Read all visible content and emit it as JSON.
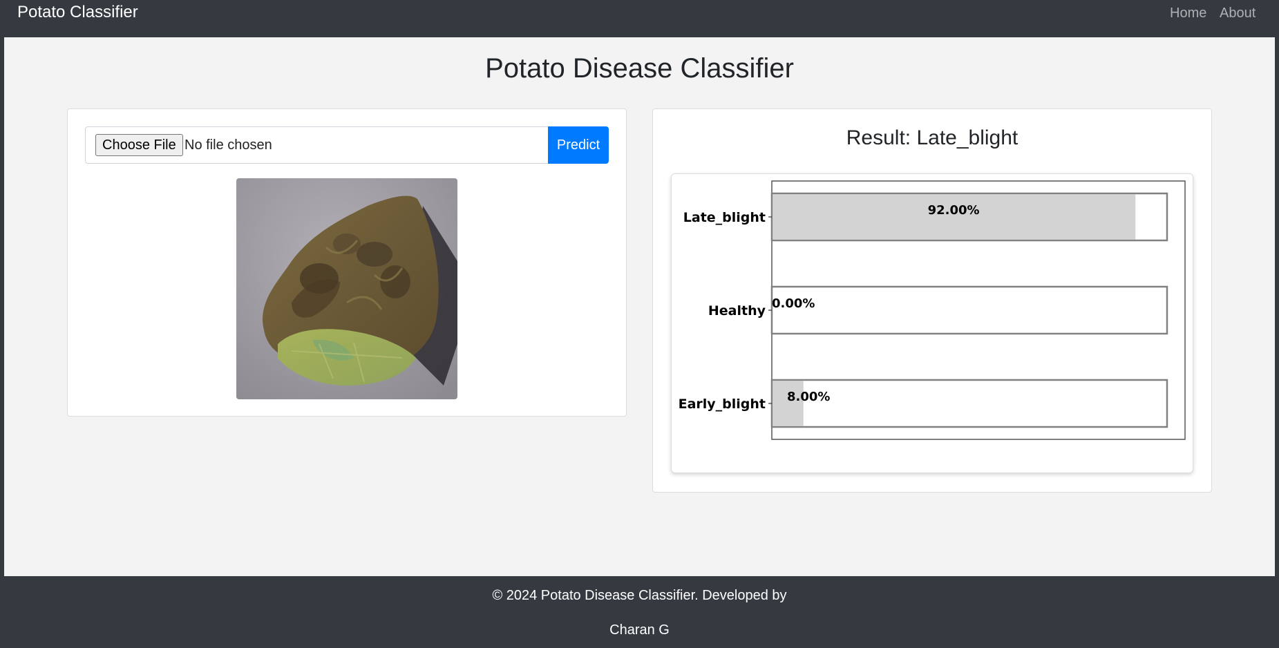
{
  "navbar": {
    "brand": "Potato Classifier",
    "links": [
      "Home",
      "About"
    ]
  },
  "page": {
    "title": "Potato Disease Classifier"
  },
  "upload": {
    "choose_label": "Choose File",
    "file_status": "No file chosen",
    "predict_label": "Predict"
  },
  "result": {
    "title": "Result: Late_blight"
  },
  "chart_data": {
    "type": "bar",
    "orientation": "horizontal",
    "categories": [
      "Late_blight",
      "Healthy",
      "Early_blight"
    ],
    "values": [
      92.0,
      0.0,
      8.0
    ],
    "value_labels": [
      "92.00%",
      "0.00%",
      "8.00%"
    ],
    "xlim": [
      0,
      100
    ],
    "bar_color": "#d3d3d3",
    "track_color": "#ffffff",
    "border_color": "#808080"
  },
  "footer": {
    "line1": "© 2024 Potato Disease Classifier. Developed by",
    "line2": "Charan G"
  },
  "colors": {
    "navbar": "#343a40",
    "primary": "#007bff",
    "background": "#f3f3f3"
  }
}
